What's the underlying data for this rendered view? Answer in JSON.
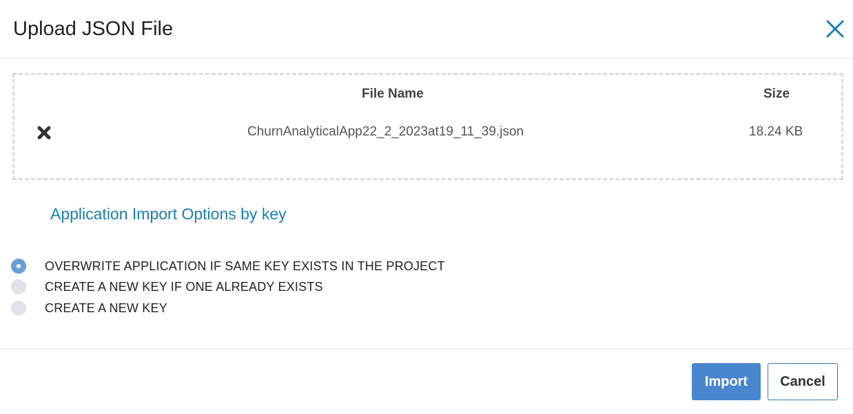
{
  "dialog": {
    "title": "Upload JSON File",
    "close_icon": "close-icon"
  },
  "file_table": {
    "headers": {
      "file_name": "File Name",
      "size": "Size"
    },
    "rows": [
      {
        "remove_icon": "remove-icon",
        "file_name": "ChurnAnalyticalApp22_2_2023at19_11_39.json",
        "size": "18.24 KB"
      }
    ]
  },
  "import_options": {
    "title": "Application Import Options by key",
    "options": [
      {
        "label": "OVERWRITE APPLICATION IF SAME KEY EXISTS IN THE PROJECT",
        "selected": true
      },
      {
        "label": "CREATE A NEW KEY IF ONE ALREADY EXISTS",
        "selected": false
      },
      {
        "label": "CREATE A NEW KEY",
        "selected": false
      }
    ]
  },
  "footer": {
    "import_label": "Import",
    "cancel_label": "Cancel"
  },
  "colors": {
    "accent": "#1a7fb0",
    "primary_button": "#4a86cf",
    "radio_selected": "#6b9ed4",
    "radio_unselected": "#e1e3e8"
  }
}
